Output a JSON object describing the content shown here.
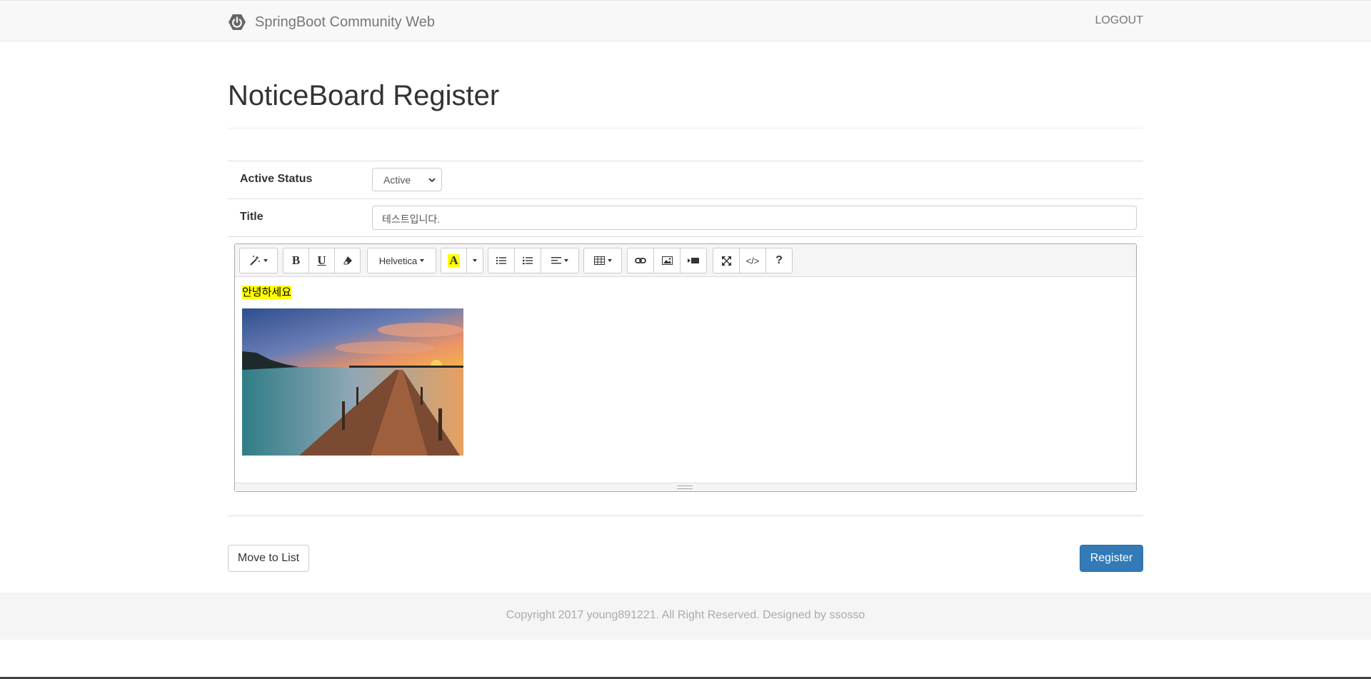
{
  "navbar": {
    "brand": "SpringBoot Community Web",
    "brand_icon": "power-icon",
    "logout": "LOGOUT"
  },
  "page": {
    "title": "NoticeBoard Register"
  },
  "form": {
    "status_label": "Active Status",
    "status_value": "Active",
    "title_label": "Title",
    "title_value": "테스트입니다."
  },
  "editor": {
    "toolbar": {
      "style": "magic-icon",
      "bold": "B",
      "underline": "U",
      "clear": "eraser-icon",
      "font_name": "Helvetica",
      "color": "A",
      "ul": "unordered-list-icon",
      "ol": "ordered-list-icon",
      "paragraph": "align-left-icon",
      "table": "table-icon",
      "link": "link-icon",
      "picture": "picture-icon",
      "video": "video-icon",
      "fullscreen": "fullscreen-icon",
      "codeview": "</>",
      "help": "?"
    },
    "content_text": "안녕하세요",
    "highlight_color": "#ffff00"
  },
  "actions": {
    "list_button": "Move to List",
    "register_button": "Register"
  },
  "footer": {
    "copyright": "Copyright 2017 young891221. All Right Reserved. Designed by ssosso"
  },
  "colors": {
    "primary": "#337ab7",
    "navbar_bg": "#f8f8f8",
    "footer_bg": "#f5f5f5"
  }
}
